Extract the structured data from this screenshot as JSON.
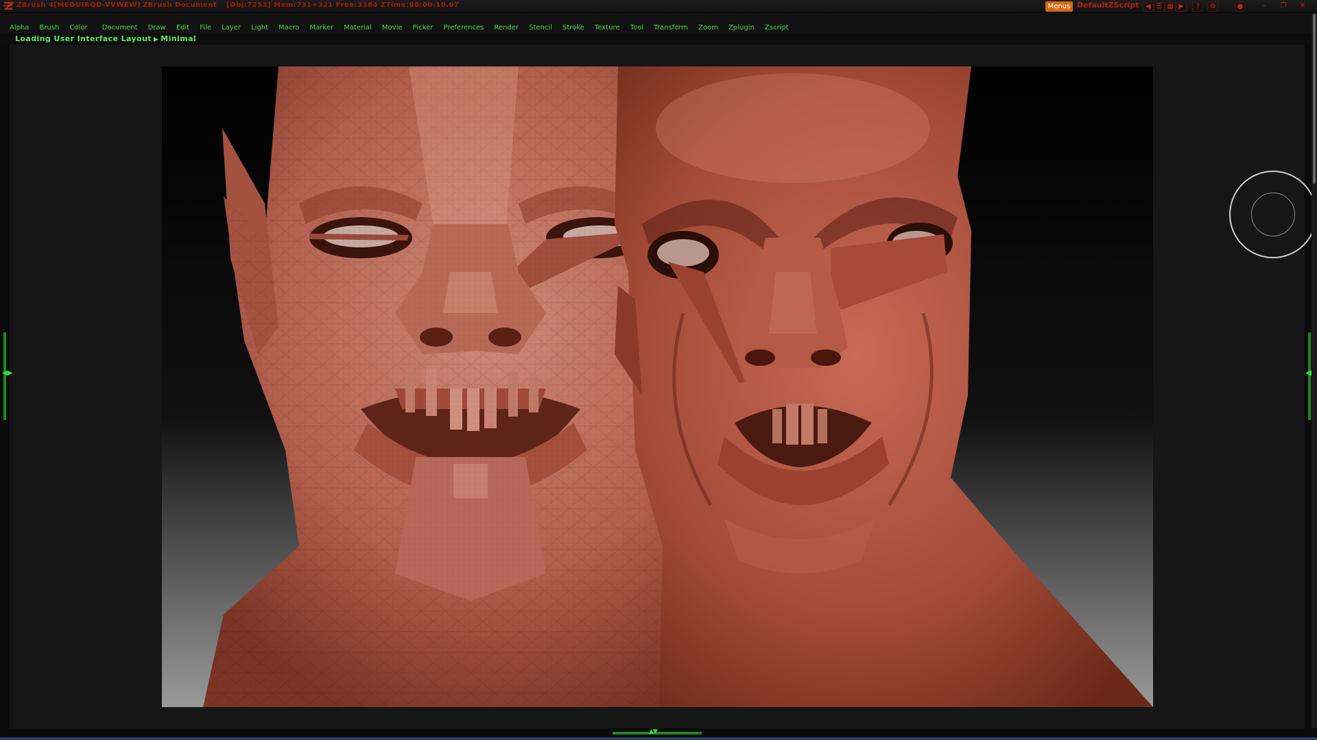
{
  "titlebar": {
    "app_title": "ZBrush 4[MEDUIRQD-VVWEW]",
    "document": "ZBrush Document",
    "stats": "[Obj:7253] Mem:731+321 Free:3364 ZTime:00:00:10.07",
    "menus_button": "Menus",
    "script_name": "DefaultZScript",
    "icons": [
      "prev-icon",
      "list-icon",
      "grid-icon",
      "next-icon",
      "help-icon",
      "gear-icon",
      "record-icon",
      "minimize-icon",
      "restore-icon",
      "close-icon"
    ],
    "icon_glyphs": [
      "◀",
      "☰",
      "▦",
      "▶",
      "?",
      "⚙",
      "●",
      "–",
      "❐",
      "✕"
    ]
  },
  "menubar": {
    "items": [
      "Alpha",
      "Brush",
      "Color",
      "Document",
      "Draw",
      "Edit",
      "File",
      "Layer",
      "Light",
      "Macro",
      "Marker",
      "Material",
      "Movie",
      "Picker",
      "Preferences",
      "Render",
      "Stencil",
      "Stroke",
      "Texture",
      "Tool",
      "Transform",
      "Zoom",
      "Zplugin",
      "Zscript"
    ]
  },
  "status": {
    "text": "Loading User Interface Layout",
    "arrow": "▶",
    "sub": "Minimal"
  },
  "side_trays": {
    "left_arrow": "◀▶",
    "right_arrow": "◀▶"
  },
  "bottom_tray": {
    "arrows": "▲▼"
  },
  "colors": {
    "menu_green": "#4fd24f",
    "title_red": "#a01c0c",
    "menus_orange": "#d86818",
    "tray_green": "#1e8a1e",
    "skin": "#b65a48"
  }
}
